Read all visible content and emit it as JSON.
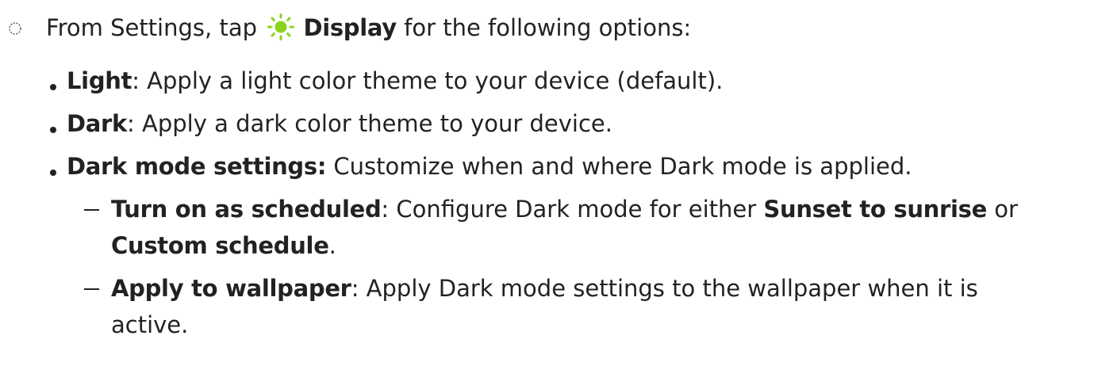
{
  "step": {
    "prefix": "From Settings, tap",
    "target": "Display",
    "suffix": "for the following options:",
    "icon": "sun-icon",
    "icon_color": "#8bd41e"
  },
  "bullets": [
    {
      "term": "Light",
      "text": ": Apply a light color theme to your device (default)."
    },
    {
      "term": "Dark",
      "text": ": Apply a dark color theme to your device."
    },
    {
      "term": "Dark mode settings:",
      "text": " Customize when and where Dark mode is applied."
    }
  ],
  "sub_bullets": [
    {
      "term": "Turn on as scheduled",
      "text1": ": Configure Dark mode for either ",
      "term2": "Sunset to sunrise",
      "text2": " or",
      "line2_term": "Custom schedule",
      "line2_text": "."
    },
    {
      "term": "Apply to wallpaper",
      "text1": ": Apply Dark mode settings to the wallpaper when it is",
      "line2_text": "active."
    }
  ]
}
